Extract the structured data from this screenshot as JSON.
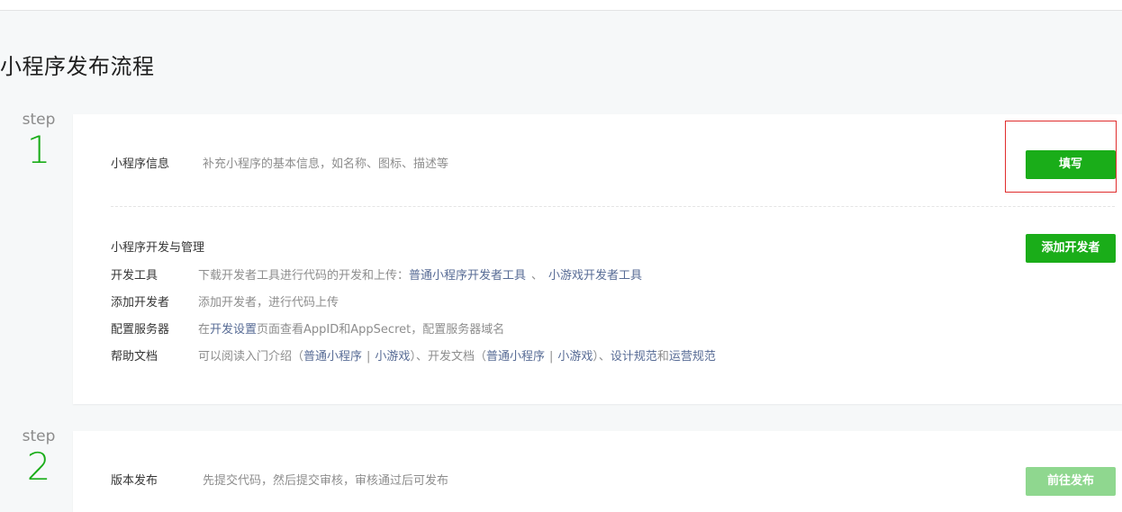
{
  "page": {
    "title": "小程序发布流程"
  },
  "step1": {
    "step_label": "step",
    "step_number": "1",
    "info": {
      "title": "小程序信息",
      "desc": "补充小程序的基本信息，如名称、图标、描述等",
      "button": "填写"
    },
    "dev": {
      "title": "小程序开发与管理",
      "button": "添加开发者",
      "tools": {
        "key": "开发工具",
        "text": "下载开发者工具进行代码的开发和上传：",
        "link1": "普通小程序开发者工具",
        "sep": "、",
        "link2": "小游戏开发者工具"
      },
      "add_dev": {
        "key": "添加开发者",
        "text": "添加开发者，进行代码上传"
      },
      "server": {
        "key": "配置服务器",
        "text_pre": "在",
        "link": "开发设置",
        "text_post": "页面查看AppID和AppSecret，配置服务器域名"
      },
      "docs": {
        "key": "帮助文档",
        "t1": "可以阅读入门介绍（",
        "l1": "普通小程序",
        "bar1": "|",
        "l2": "小游戏",
        "t2": "）、开发文档（",
        "l3": "普通小程序",
        "bar2": "|",
        "l4": "小游戏",
        "t3": "）、",
        "l5": "设计规范",
        "t4": "和",
        "l6": "运营规范"
      }
    }
  },
  "step2": {
    "step_label": "step",
    "step_number": "2",
    "publish": {
      "title": "版本发布",
      "desc": "先提交代码，然后提交审核，审核通过后可发布",
      "button": "前往发布"
    }
  }
}
